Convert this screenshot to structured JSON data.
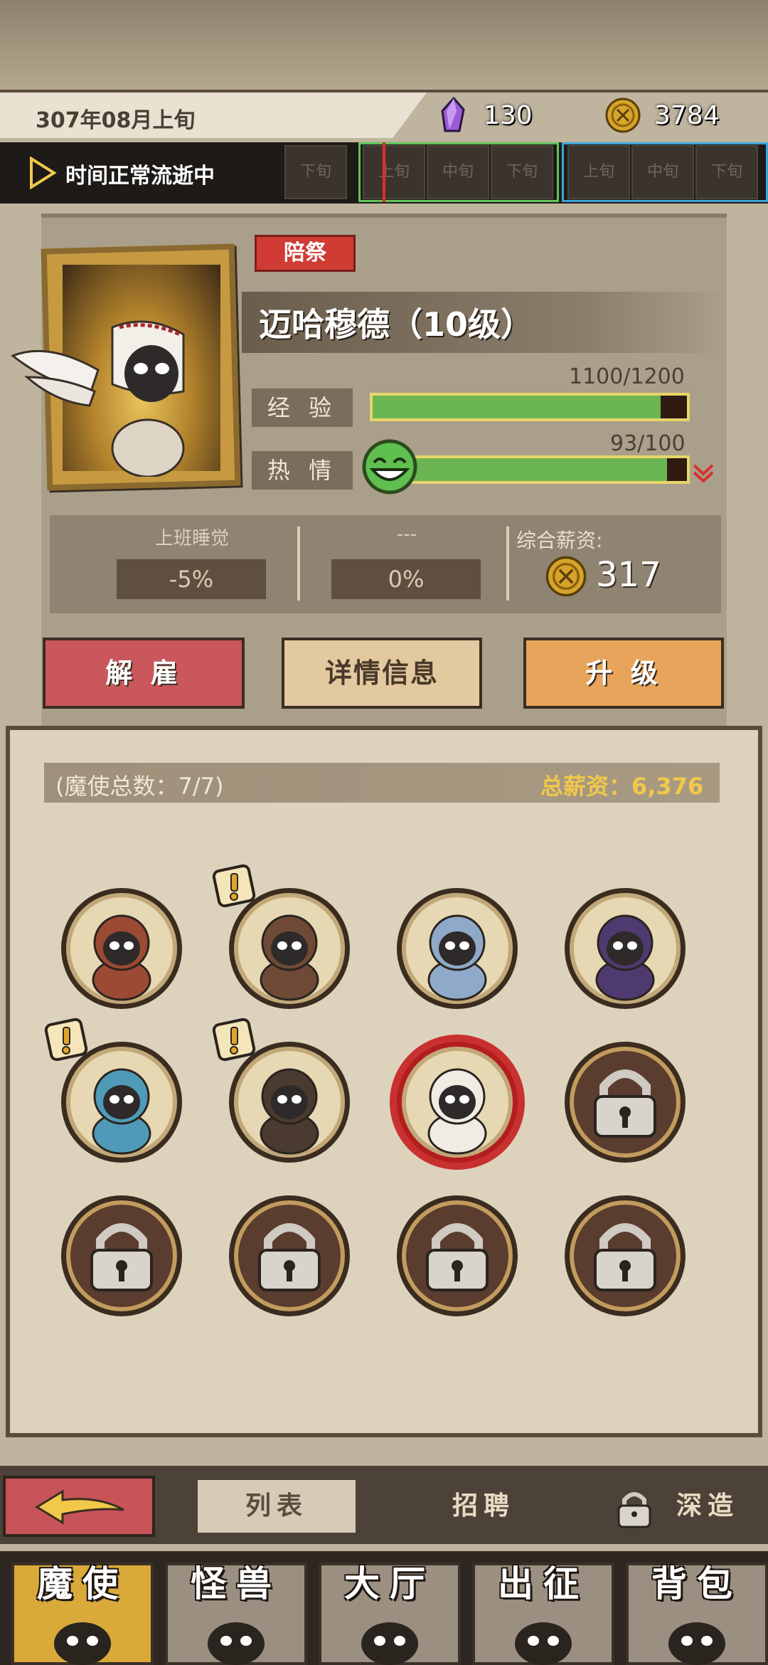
{
  "header": {
    "date": "307年08月上旬",
    "crystal_count": "130",
    "coin_count": "3784",
    "time_status": "时间正常流逝中"
  },
  "timeline": {
    "slots": [
      "下旬",
      "上旬",
      "中旬",
      "下旬",
      "上旬",
      "中旬",
      "下旬"
    ]
  },
  "demon": {
    "role": "陪祭",
    "name": "迈哈穆德（10级）",
    "exp_label": "经 验",
    "exp_value": "1100/1200",
    "exp_fraction": 0.917,
    "passion_label": "热 情",
    "passion_value": "93/100",
    "passion_fraction": 0.93
  },
  "modifiers": [
    {
      "title": "上班睡觉",
      "value": "-5%"
    },
    {
      "title": "---",
      "value": "0%"
    }
  ],
  "salary": {
    "title": "综合薪资:",
    "value": "317"
  },
  "actions": {
    "fire": "解 雇",
    "detail": "详情信息",
    "upgrade": "升 级"
  },
  "roster": {
    "count": "(魔使总数：7/7)",
    "total_salary": "总薪资：6,376",
    "slots": [
      {
        "state": "filled",
        "alert": false,
        "icon": "demon-masked-icon"
      },
      {
        "state": "filled",
        "alert": true,
        "icon": "demon-warrior-icon"
      },
      {
        "state": "filled",
        "alert": false,
        "icon": "demon-horned-icon"
      },
      {
        "state": "filled",
        "alert": false,
        "icon": "demon-witch-icon"
      },
      {
        "state": "filled",
        "alert": true,
        "icon": "demon-hooded-icon"
      },
      {
        "state": "filled",
        "alert": true,
        "icon": "demon-beast-icon"
      },
      {
        "state": "selected",
        "alert": false,
        "icon": "demon-winged-icon"
      },
      {
        "state": "locked",
        "alert": false,
        "icon": "padlock-icon"
      },
      {
        "state": "locked",
        "alert": false,
        "icon": "padlock-icon"
      },
      {
        "state": "locked",
        "alert": false,
        "icon": "padlock-icon"
      },
      {
        "state": "locked",
        "alert": false,
        "icon": "padlock-icon"
      },
      {
        "state": "locked",
        "alert": false,
        "icon": "padlock-icon"
      }
    ]
  },
  "subnav": {
    "list": "列表",
    "recruit": "招聘",
    "deep": "深造"
  },
  "mainnav": [
    {
      "label": "魔使",
      "icon": "skull-icon",
      "active": true
    },
    {
      "label": "怪兽",
      "icon": "monster-icon",
      "active": false
    },
    {
      "label": "大厅",
      "icon": "hall-icon",
      "active": false
    },
    {
      "label": "出征",
      "icon": "battle-icon",
      "active": false
    },
    {
      "label": "背包",
      "icon": "backpack-icon",
      "active": false
    }
  ],
  "colors": {
    "accent_red": "#c9575c",
    "accent_orange": "#e8a45a",
    "bar_green": "#6bb552",
    "gold": "#f2c84a"
  }
}
